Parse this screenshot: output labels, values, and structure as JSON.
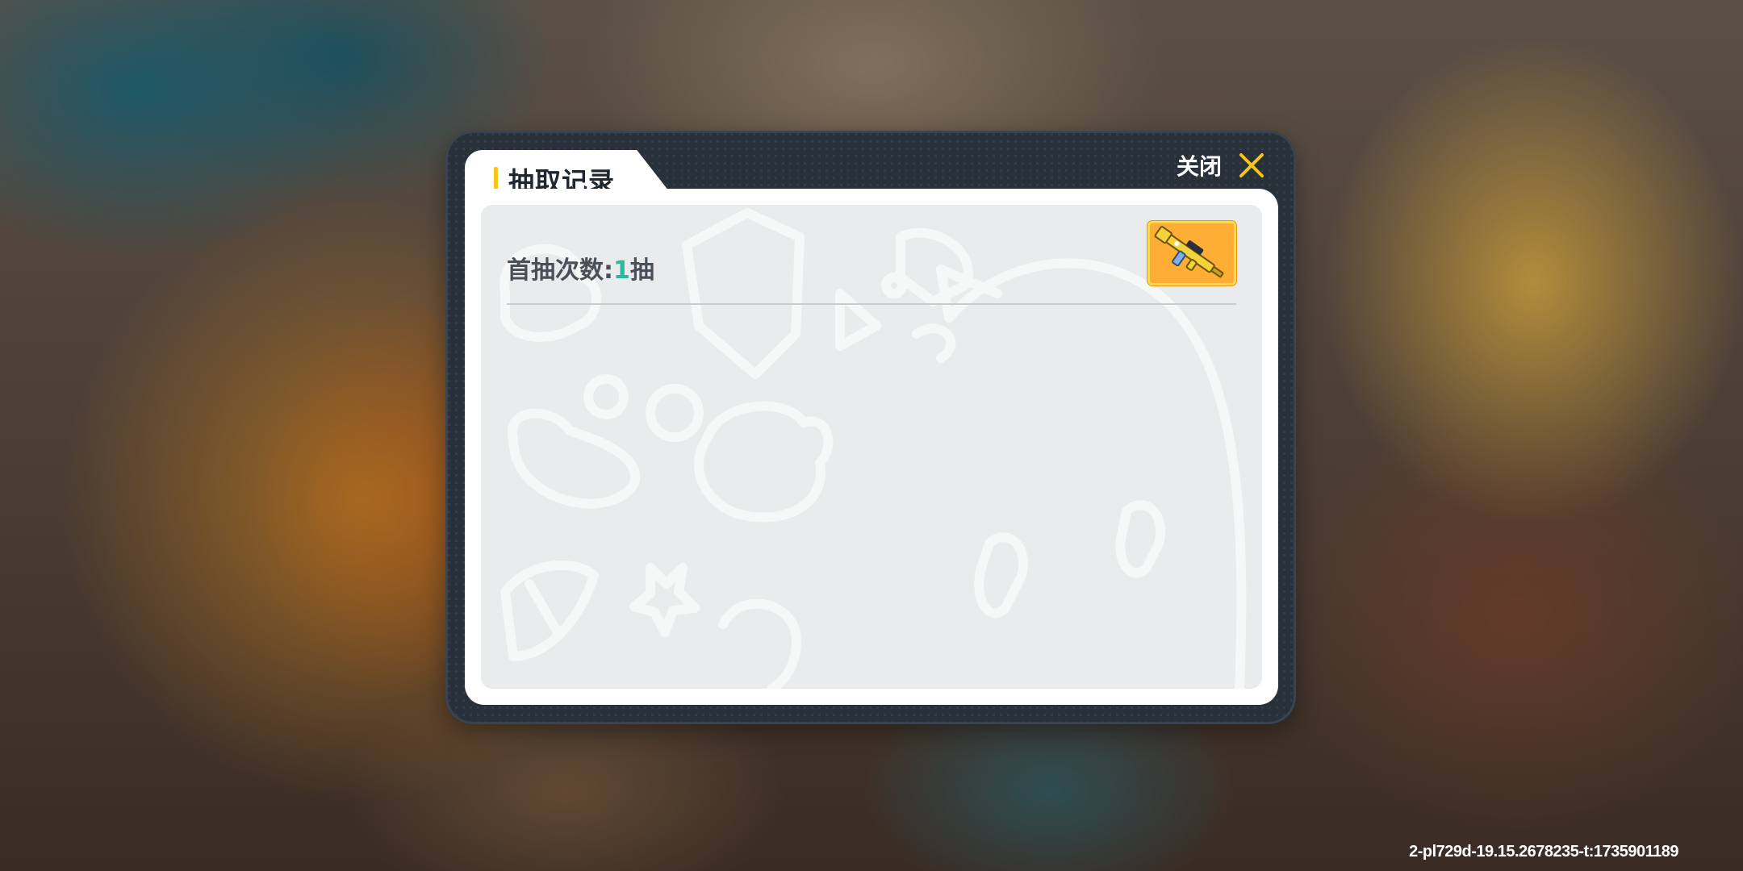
{
  "dialog": {
    "title": "抽取记录",
    "close_label": "关闭",
    "close_icon": "x-close-icon",
    "accent_color": "#f5c518"
  },
  "records": [
    {
      "label_prefix": "首抽次数:",
      "count": "1",
      "label_suffix": "抽",
      "reward_icon": "assault-rifle-icon",
      "reward_slot_color": "#ffae35"
    }
  ],
  "footer": {
    "build_id": "2-pl729d-19.15.2678235-t:1735901189"
  }
}
